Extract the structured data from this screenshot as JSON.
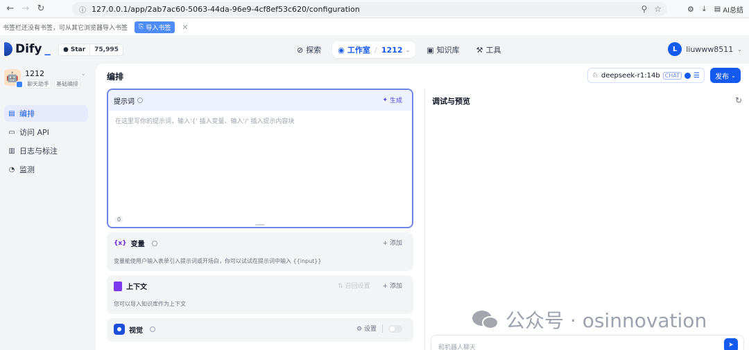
{
  "browser": {
    "url": "127.0.0.1/app/2ab7ac60-5063-44da-96e9-4cf8ef53c620/configuration",
    "ai_label": "AI总结"
  },
  "bookmarks": {
    "hint": "书签栏还没有书签，可从其它浏览器导入书签",
    "import_label": "导入书签"
  },
  "header": {
    "logo": "Dify",
    "github_label": "Star",
    "github_count": "75,995",
    "nav": {
      "explore": "探索",
      "studio": "工作室",
      "app": "1212",
      "knowledge": "知识库",
      "tools": "工具"
    },
    "user_initial": "L",
    "user_name": "liuwww8511"
  },
  "sidebar": {
    "app_name": "1212",
    "tags": [
      "聊天助手",
      "基础编排"
    ],
    "items": [
      {
        "label": "编排",
        "icon": "layout-icon",
        "active": true
      },
      {
        "label": "访问 API",
        "icon": "terminal-icon"
      },
      {
        "label": "日志与标注",
        "icon": "log-icon"
      },
      {
        "label": "监测",
        "icon": "monitor-icon"
      }
    ]
  },
  "main": {
    "title": "编排",
    "model_name": "deepseek-r1:14b",
    "model_tag": "CHAT",
    "publish_label": "发布",
    "prompt": {
      "title": "提示词",
      "generate_label": "生成",
      "placeholder": "在这里写你的提示词，输入'{' 插入变量、输入'/' 插入提示内容块",
      "count": "0"
    },
    "variables": {
      "title": "变量",
      "add_label": "添加",
      "description": "变量能使用户输入表单引入提示词或开场白，你可以试试在提示词中输入 {{input}}"
    },
    "context": {
      "title": "上下文",
      "recall_label": "召回设置",
      "add_label": "添加",
      "description": "您可以导入知识库作为上下文"
    },
    "vision": {
      "title": "视觉",
      "settings_label": "设置"
    }
  },
  "preview": {
    "title": "调试与预览",
    "input_placeholder": "和机器人聊天",
    "watermark": "公众号 · osinnovation"
  },
  "colors": {
    "accent": "#155aef",
    "prompt_border": "#6f83e8"
  }
}
